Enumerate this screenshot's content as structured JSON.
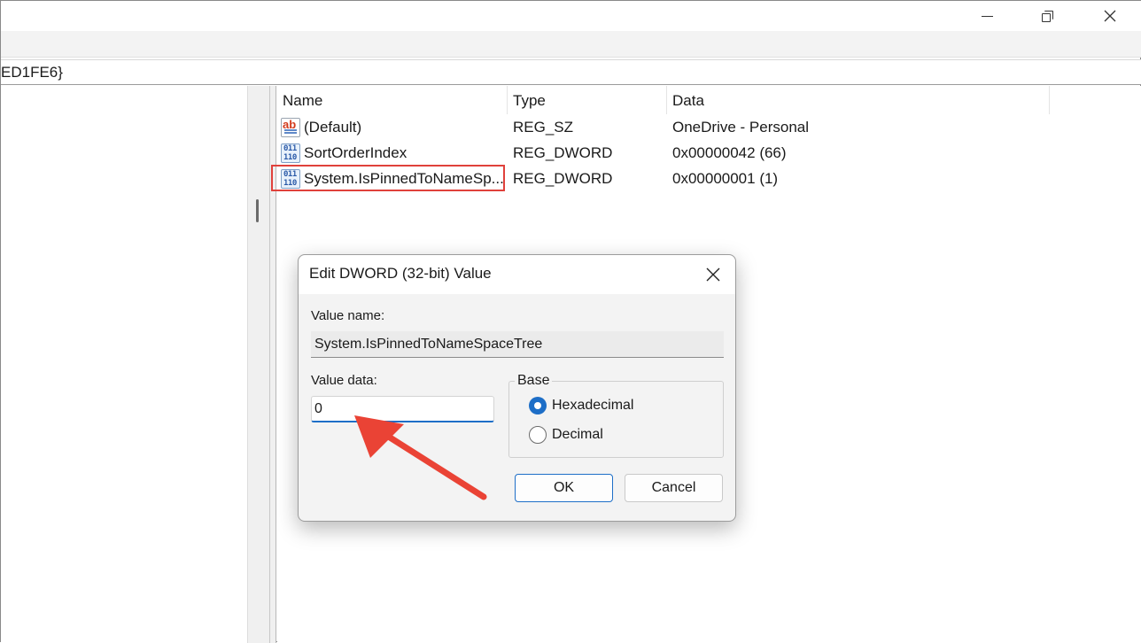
{
  "address": {
    "path_text": "ED1FE6}"
  },
  "window_controls": {
    "minimize_icon": "minimize-icon",
    "restore_icon": "restore-icon",
    "close_icon": "close-icon"
  },
  "list": {
    "columns": [
      "Name",
      "Type",
      "Data"
    ],
    "rows": [
      {
        "icon": "reg-sz-icon",
        "name": "(Default)",
        "type": "REG_SZ",
        "data": "OneDrive - Personal"
      },
      {
        "icon": "reg-dword-icon",
        "name": "SortOrderIndex",
        "type": "REG_DWORD",
        "data": "0x00000042 (66)"
      },
      {
        "icon": "reg-dword-icon",
        "name": "System.IsPinnedToNameSp...",
        "type": "REG_DWORD",
        "data": "0x00000001 (1)",
        "highlighted": true
      }
    ]
  },
  "dialog": {
    "title": "Edit DWORD (32-bit) Value",
    "value_name_label": "Value name:",
    "value_name": "System.IsPinnedToNameSpaceTree",
    "value_data_label": "Value data:",
    "value_data": "0",
    "base_label": "Base",
    "base_options": [
      {
        "label": "Hexadecimal",
        "checked": true
      },
      {
        "label": "Decimal",
        "checked": false
      }
    ],
    "ok_label": "OK",
    "cancel_label": "Cancel"
  },
  "colors": {
    "accent": "#1d6ec7",
    "highlight_box": "#e0413b",
    "arrow": "#ea4335"
  }
}
